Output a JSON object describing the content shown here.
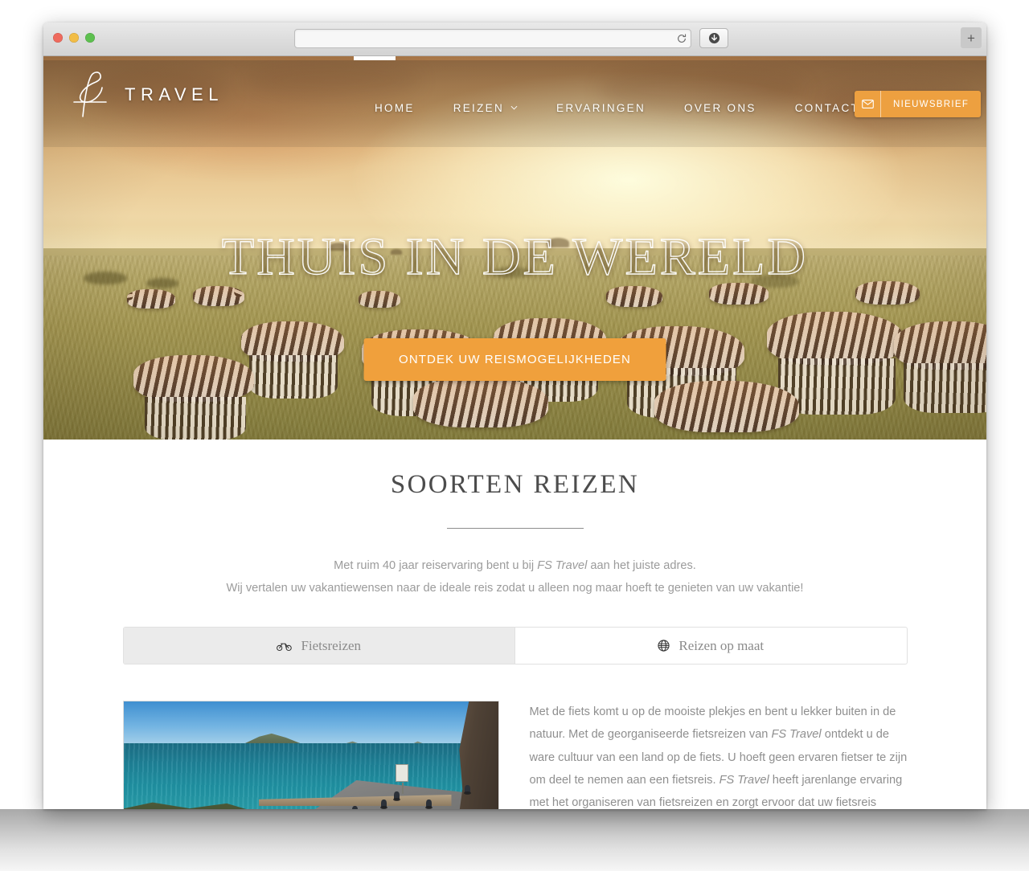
{
  "browser": {
    "url_value": "",
    "url_placeholder": "",
    "reload_icon": "reload-icon",
    "download_icon": "download-icon",
    "newtab_label": "+",
    "traffic_lights": [
      "close",
      "minimize",
      "zoom"
    ]
  },
  "site": {
    "logo_text": "TRAVEL",
    "logo_mark": "fs-monogram",
    "nav": [
      {
        "label": "HOME",
        "caret": ""
      },
      {
        "label": "REIZEN",
        "caret": "⌄"
      },
      {
        "label": "ERVARINGEN",
        "caret": ""
      },
      {
        "label": "OVER ONS",
        "caret": ""
      },
      {
        "label": "CONTACT",
        "caret": ""
      }
    ],
    "newsletter": {
      "icon": "envelope-icon",
      "label": "NIEUWSBRIEF",
      "color": "#eda040"
    }
  },
  "hero": {
    "title": "THUIS IN DE WERELD",
    "cta_label": "ONTDEK UW REISMOGELIJKHEDEN",
    "cta_color": "#f0a03c",
    "image_alt": "zebra-herd-savanna"
  },
  "section": {
    "title": "SOORTEN REIZEN",
    "intro_line1_before": "Met ruim 40 jaar reiservaring bent u bij ",
    "intro_line1_em": "FS Travel",
    "intro_line1_after": " aan het juiste adres.",
    "intro_line2": "Wij vertalen uw vakantiewensen naar de ideale reis zodat u alleen nog maar hoeft te genieten van uw vakantie!",
    "tabs": [
      {
        "label": "Fietsreizen",
        "icon": "bicycle-icon",
        "active": true
      },
      {
        "label": "Reizen op maat",
        "icon": "globe-icon",
        "active": false
      }
    ],
    "panel": {
      "image_alt": "cyclists-coastal-road",
      "p1": "Met de fiets komt u op de mooiste plekjes en bent u lekker buiten in de natuur. Met de georganiseerde fietsreizen van ",
      "em1": "FS Travel",
      "p2": " ontdekt u de ware cultuur van een land op de fiets. U hoeft geen ervaren fietser te zijn om deel te nemen aan een fietsreis. ",
      "em2": "FS Travel",
      "p3": " heeft jarenlange ervaring met het organiseren van fietsreizen en zorgt ervoor dat uw fietsreis onvergetelijk wordt"
    }
  }
}
